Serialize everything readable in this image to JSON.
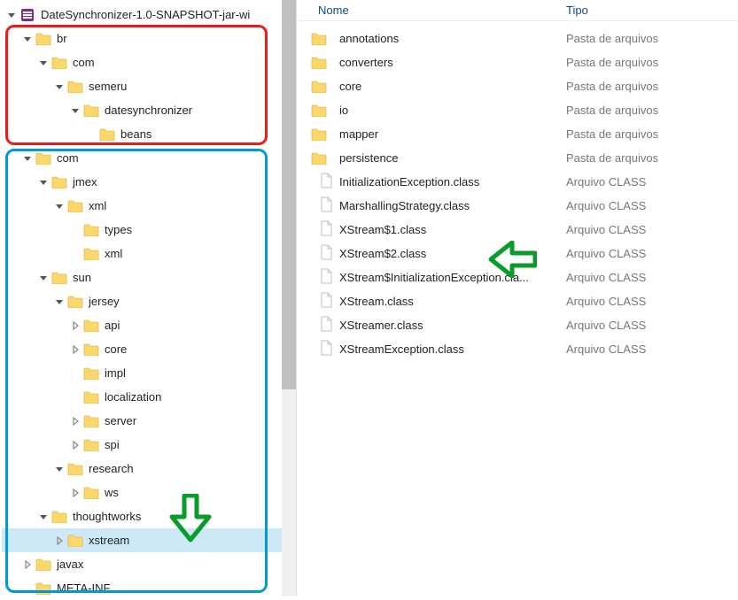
{
  "root_label": "DateSynchronizer-1.0-SNAPSHOT-jar-wi",
  "tree": [
    {
      "depth": 0,
      "exp": "open",
      "icon": "app",
      "label_key": "root_label"
    },
    {
      "depth": 1,
      "exp": "open",
      "icon": "folder",
      "label": "br"
    },
    {
      "depth": 2,
      "exp": "open",
      "icon": "folder",
      "label": "com"
    },
    {
      "depth": 3,
      "exp": "open",
      "icon": "folder",
      "label": "semeru"
    },
    {
      "depth": 4,
      "exp": "open",
      "icon": "folder",
      "label": "datesynchronizer"
    },
    {
      "depth": 5,
      "exp": "none",
      "icon": "folder",
      "label": "beans"
    },
    {
      "depth": 1,
      "exp": "open",
      "icon": "folder",
      "label": "com"
    },
    {
      "depth": 2,
      "exp": "open",
      "icon": "folder",
      "label": "jmex"
    },
    {
      "depth": 3,
      "exp": "open",
      "icon": "folder",
      "label": "xml"
    },
    {
      "depth": 4,
      "exp": "none",
      "icon": "folder",
      "label": "types"
    },
    {
      "depth": 4,
      "exp": "none",
      "icon": "folder",
      "label": "xml"
    },
    {
      "depth": 2,
      "exp": "open",
      "icon": "folder",
      "label": "sun"
    },
    {
      "depth": 3,
      "exp": "open",
      "icon": "folder",
      "label": "jersey"
    },
    {
      "depth": 4,
      "exp": "closed",
      "icon": "folder",
      "label": "api"
    },
    {
      "depth": 4,
      "exp": "closed",
      "icon": "folder",
      "label": "core"
    },
    {
      "depth": 4,
      "exp": "none",
      "icon": "folder",
      "label": "impl"
    },
    {
      "depth": 4,
      "exp": "none",
      "icon": "folder",
      "label": "localization"
    },
    {
      "depth": 4,
      "exp": "closed",
      "icon": "folder",
      "label": "server"
    },
    {
      "depth": 4,
      "exp": "closed",
      "icon": "folder",
      "label": "spi"
    },
    {
      "depth": 3,
      "exp": "open",
      "icon": "folder",
      "label": "research"
    },
    {
      "depth": 4,
      "exp": "closed",
      "icon": "folder",
      "label": "ws"
    },
    {
      "depth": 2,
      "exp": "open",
      "icon": "folder",
      "label": "thoughtworks"
    },
    {
      "depth": 3,
      "exp": "closed",
      "icon": "folder",
      "label": "xstream",
      "selected": true
    },
    {
      "depth": 1,
      "exp": "closed",
      "icon": "folder",
      "label": "javax"
    },
    {
      "depth": 1,
      "exp": "none",
      "icon": "folder",
      "label": "META-INF"
    }
  ],
  "columns": {
    "nome": "Nome",
    "tipo": "Tipo"
  },
  "type_folder": "Pasta de arquivos",
  "type_class": "Arquivo CLASS",
  "files": [
    {
      "icon": "folder",
      "name": "annotations",
      "type_key": "type_folder"
    },
    {
      "icon": "folder",
      "name": "converters",
      "type_key": "type_folder"
    },
    {
      "icon": "folder",
      "name": "core",
      "type_key": "type_folder"
    },
    {
      "icon": "folder",
      "name": "io",
      "type_key": "type_folder"
    },
    {
      "icon": "folder",
      "name": "mapper",
      "type_key": "type_folder"
    },
    {
      "icon": "folder",
      "name": "persistence",
      "type_key": "type_folder"
    },
    {
      "icon": "doc",
      "name": "InitializationException.class",
      "type_key": "type_class"
    },
    {
      "icon": "doc",
      "name": "MarshallingStrategy.class",
      "type_key": "type_class"
    },
    {
      "icon": "doc",
      "name": "XStream$1.class",
      "type_key": "type_class"
    },
    {
      "icon": "doc",
      "name": "XStream$2.class",
      "type_key": "type_class"
    },
    {
      "icon": "doc",
      "name": "XStream$InitializationException.cla...",
      "type_key": "type_class"
    },
    {
      "icon": "doc",
      "name": "XStream.class",
      "type_key": "type_class"
    },
    {
      "icon": "doc",
      "name": "XStreamer.class",
      "type_key": "type_class"
    },
    {
      "icon": "doc",
      "name": "XStreamException.class",
      "type_key": "type_class"
    }
  ]
}
